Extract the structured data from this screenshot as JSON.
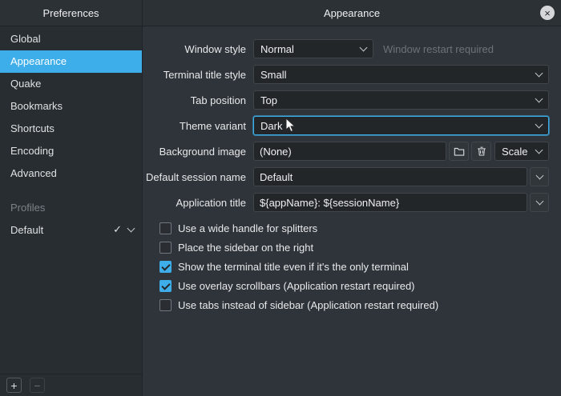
{
  "header": {
    "sidebar_title": "Preferences",
    "page_title": "Appearance",
    "close_icon": "×"
  },
  "sidebar": {
    "items": [
      {
        "label": "Global",
        "selected": false
      },
      {
        "label": "Appearance",
        "selected": true
      },
      {
        "label": "Quake",
        "selected": false
      },
      {
        "label": "Bookmarks",
        "selected": false
      },
      {
        "label": "Shortcuts",
        "selected": false
      },
      {
        "label": "Encoding",
        "selected": false
      },
      {
        "label": "Advanced",
        "selected": false
      }
    ],
    "profiles_header": "Profiles",
    "profile": {
      "label": "Default",
      "check_icon": "✓"
    },
    "add_button": "+",
    "remove_button": "−"
  },
  "form": {
    "window_style": {
      "label": "Window style",
      "value": "Normal",
      "hint": "Window restart required"
    },
    "terminal_title_style": {
      "label": "Terminal title style",
      "value": "Small"
    },
    "tab_position": {
      "label": "Tab position",
      "value": "Top"
    },
    "theme_variant": {
      "label": "Theme variant",
      "value": "Dark"
    },
    "background_image": {
      "label": "Background image",
      "value": "(None)",
      "scale_mode": "Scale"
    },
    "default_session_name": {
      "label": "Default session name",
      "value": "Default"
    },
    "application_title": {
      "label": "Application title",
      "value": "${appName}: ${sessionName}"
    }
  },
  "checkboxes": [
    {
      "label": "Use a wide handle for splitters",
      "checked": false
    },
    {
      "label": "Place the sidebar on the right",
      "checked": false
    },
    {
      "label": "Show the terminal title even if it's the only terminal",
      "checked": true
    },
    {
      "label": "Use overlay scrollbars (Application restart required)",
      "checked": true
    },
    {
      "label": "Use tabs instead of sidebar (Application restart required)",
      "checked": false
    }
  ],
  "colors": {
    "accent": "#3daee9",
    "panel_bg": "#2f343b",
    "sidebar_bg": "#282d32",
    "field_bg": "#232629",
    "hint_text": "#6d7277"
  }
}
